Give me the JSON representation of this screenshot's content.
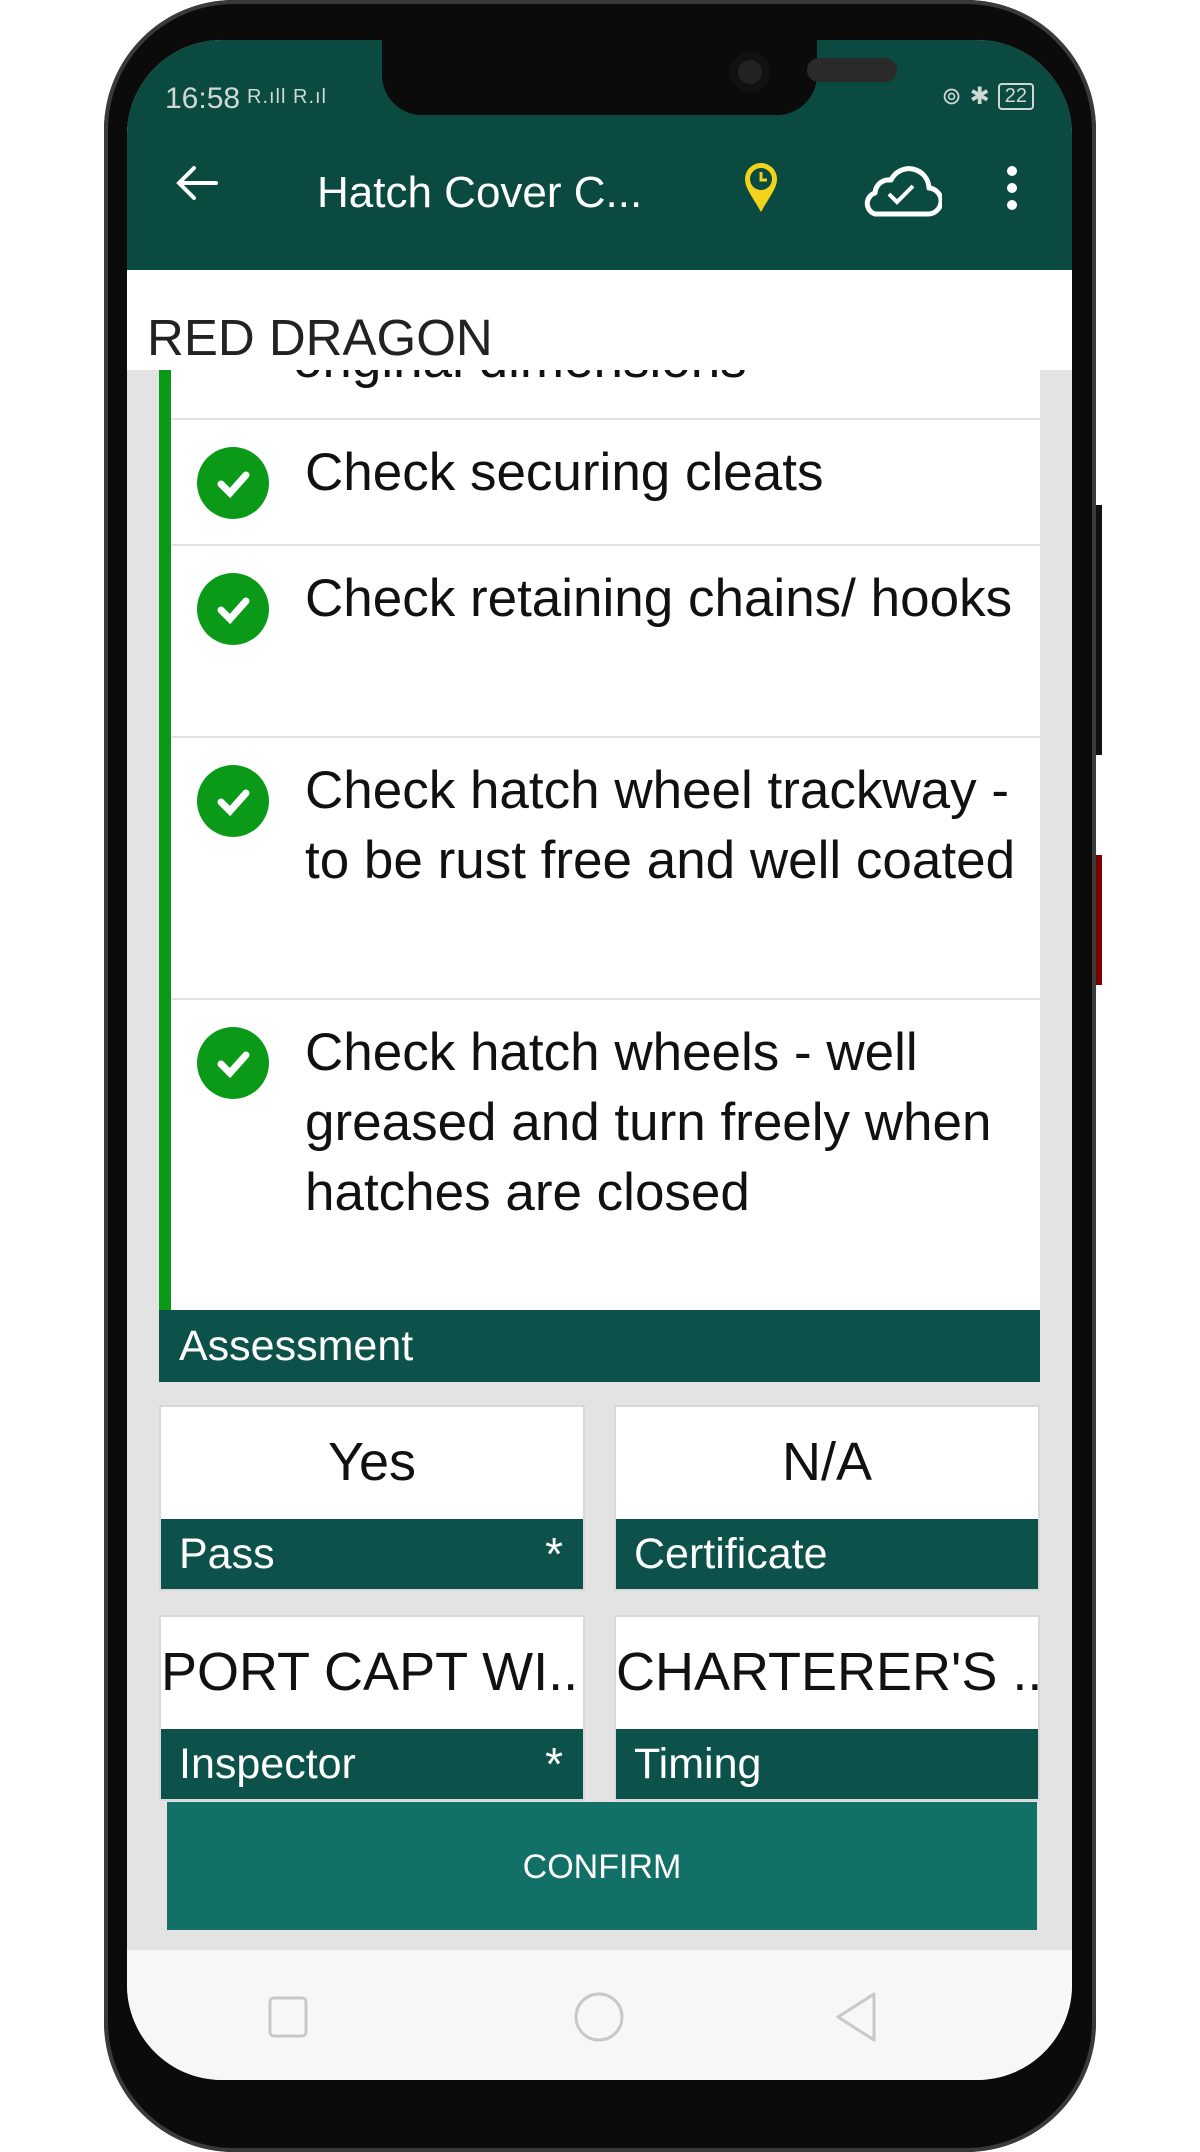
{
  "status_bar": {
    "time": "16:58",
    "signal": "R.ıll R.ıl",
    "battery": "22"
  },
  "app_bar": {
    "title": "Hatch Cover C...",
    "icons": [
      "back-arrow-icon",
      "location-clock-icon",
      "cloud-check-icon",
      "more-vert-icon"
    ]
  },
  "vessel_name": "RED DRAGON",
  "checklist": {
    "partial_item": "original dimensions",
    "items": [
      {
        "label": "Check securing cleats",
        "status": "checked"
      },
      {
        "label": "Check retaining chains/ hooks",
        "status": "checked"
      },
      {
        "label": "Check hatch wheel trackway - to be rust free and well coated",
        "status": "checked"
      },
      {
        "label": "Check hatch wheels - well greased and turn freely when hatches are closed",
        "status": "checked"
      }
    ]
  },
  "assessment": {
    "header": "Assessment",
    "fields": [
      {
        "label": "Pass",
        "value": "Yes",
        "required": "*"
      },
      {
        "label": "Certificate",
        "value": "N/A",
        "required": ""
      },
      {
        "label": "Inspector",
        "value": "PORT CAPT WI...",
        "required": "*"
      },
      {
        "label": "Timing",
        "value": "CHARTERER'S ...",
        "required": ""
      }
    ]
  },
  "confirm_label": "CONFIRM",
  "colors": {
    "primary": "#0a4a40",
    "check": "#0a9a18",
    "button": "#127067",
    "pin": "#f2d21b"
  }
}
